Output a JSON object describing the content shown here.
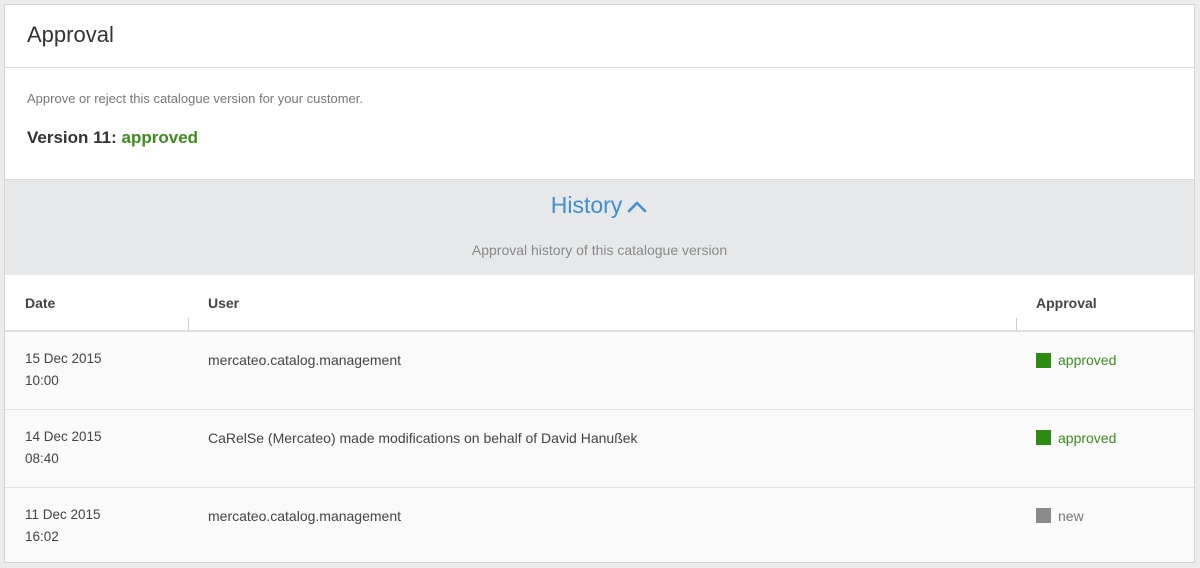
{
  "panel": {
    "title": "Approval",
    "description": "Approve or reject this catalogue version for your customer.",
    "version_label": "Version 11:",
    "version_status": "approved",
    "version_status_color": "#3c8c1c"
  },
  "history": {
    "title": "History",
    "toggle_icon": "chevron-up-icon",
    "subtitle": "Approval history of this catalogue version",
    "link_color": "#3f8fd2"
  },
  "table": {
    "columns": [
      "Date",
      "User",
      "Approval"
    ],
    "rows": [
      {
        "date": "15 Dec 2015",
        "time": "10:00",
        "user": "mercateo.catalog.management",
        "approval": "approved",
        "approval_color": "#2e8b12",
        "text_color": "#3c8c1c"
      },
      {
        "date": "14 Dec 2015",
        "time": "08:40",
        "user": "CaRelSe (Mercateo) made modifications on behalf of David Hanußek",
        "approval": "approved",
        "approval_color": "#2e8b12",
        "text_color": "#3c8c1c"
      },
      {
        "date": "11 Dec 2015",
        "time": "16:02",
        "user": "mercateo.catalog.management",
        "approval": "new",
        "approval_color": "#8a8a8a",
        "text_color": "#777777"
      }
    ]
  }
}
